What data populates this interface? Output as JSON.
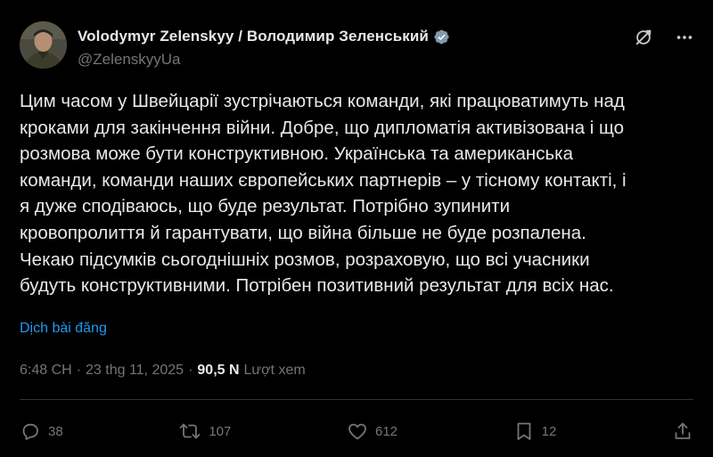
{
  "post": {
    "author": {
      "display_name": "Volodymyr Zelenskyy / Володимир Зеленський",
      "handle": "@ZelenskyyUa",
      "verified": true
    },
    "text": "Цим часом у Швейцарії зустрічаються команди, які працюватимуть над\nкроками для закінчення війни. Добре, що дипломатія активізована і що\nрозмова може бути конструктивною. Українська та американська\nкоманди, команди наших європейських партнерів – у тісному контакті, і\nя дуже сподіваюсь, що буде результат. Потрібно зупинити\nкровопролиття й гарантувати, що війна більше не буде розпалена.\nЧекаю підсумків сьогоднішніх розмов, розраховую, що всі учасники\nбудуть конструктивними. Потрібен позитивний результат для всіх нас.",
    "translate_label": "Dịch bài đăng",
    "time": "6:48 CH",
    "separator": "·",
    "date": "23 thg 11, 2025",
    "views_count": "90,5 N",
    "views_label": "Lượt xem"
  },
  "actions": {
    "replies": "38",
    "reposts": "107",
    "likes": "612",
    "bookmarks": "12"
  },
  "icons": {
    "verified": "verified-badge-icon",
    "grok": "grok-icon",
    "more": "more-options-icon",
    "reply": "reply-icon",
    "repost": "repost-icon",
    "like": "heart-icon",
    "bookmark": "bookmark-icon",
    "share": "share-icon"
  },
  "colors": {
    "background": "#000000",
    "text": "#e7e9ea",
    "muted": "#71767b",
    "link": "#1d9bf0",
    "divider": "#2f3336"
  }
}
